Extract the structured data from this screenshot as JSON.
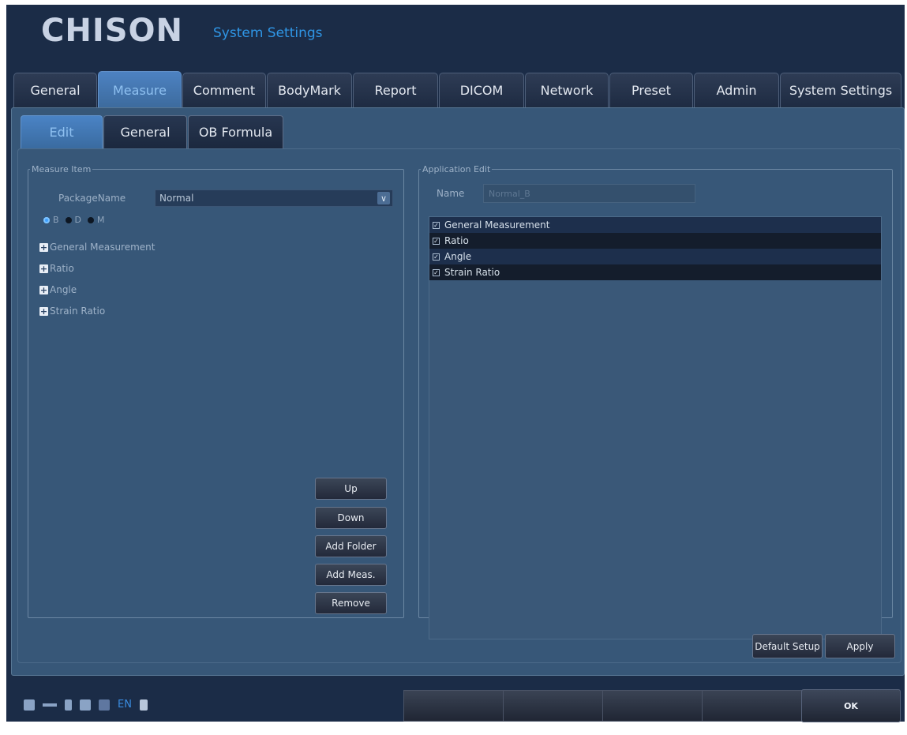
{
  "header": {
    "brand": "CHISON",
    "title": "System Settings"
  },
  "main_tabs": [
    {
      "label": "General"
    },
    {
      "label": "Measure"
    },
    {
      "label": "Comment"
    },
    {
      "label": "BodyMark"
    },
    {
      "label": "Report"
    },
    {
      "label": "DICOM"
    },
    {
      "label": "Network"
    },
    {
      "label": "Preset"
    },
    {
      "label": "Admin"
    },
    {
      "label": "System Settings"
    }
  ],
  "active_main_tab": "Measure",
  "sub_tabs": [
    {
      "label": "Edit"
    },
    {
      "label": "General"
    },
    {
      "label": "OB Formula"
    }
  ],
  "active_sub_tab": "Edit",
  "measure_item": {
    "legend": "Measure Item",
    "package_label": "PackageName",
    "package_value": "Normal",
    "modes": [
      {
        "label": "B",
        "selected": true
      },
      {
        "label": "D",
        "selected": false
      },
      {
        "label": "M",
        "selected": false
      }
    ],
    "tree": [
      {
        "label": "General Measurement"
      },
      {
        "label": "Ratio"
      },
      {
        "label": "Angle"
      },
      {
        "label": "Strain Ratio"
      }
    ],
    "buttons": {
      "up": "Up",
      "down": "Down",
      "add_folder": "Add Folder",
      "add_meas": "Add Meas.",
      "remove": "Remove"
    }
  },
  "application_edit": {
    "legend": "Application Edit",
    "name_label": "Name",
    "name_value": "Normal_B",
    "items": [
      {
        "label": "General Measurement",
        "checked": true
      },
      {
        "label": "Ratio",
        "checked": true
      },
      {
        "label": "Angle",
        "checked": true
      },
      {
        "label": "Strain Ratio",
        "checked": true
      }
    ]
  },
  "footer_buttons": {
    "default_setup": "Default Setup",
    "apply": "Apply"
  },
  "status_bar": {
    "language": "EN",
    "icons": [
      "network-icon",
      "usb-icon",
      "storage-icon",
      "printer-icon",
      "display-icon",
      "probe-icon"
    ]
  },
  "softkeys": {
    "ok": "OK"
  },
  "colors": {
    "frame_bg": "#1b2c47",
    "panel_bg": "#375778",
    "active_tab": "#4a83c5",
    "accent": "#2f96e6"
  }
}
